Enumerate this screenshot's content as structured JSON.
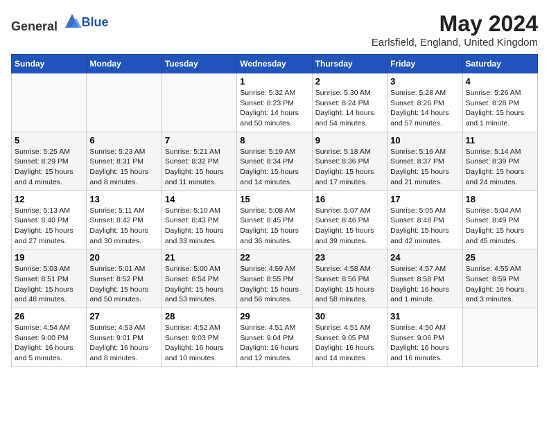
{
  "header": {
    "logo_general": "General",
    "logo_blue": "Blue",
    "title": "May 2024",
    "subtitle": "Earlsfield, England, United Kingdom"
  },
  "days_of_week": [
    "Sunday",
    "Monday",
    "Tuesday",
    "Wednesday",
    "Thursday",
    "Friday",
    "Saturday"
  ],
  "weeks": [
    [
      {
        "day": "",
        "info": ""
      },
      {
        "day": "",
        "info": ""
      },
      {
        "day": "",
        "info": ""
      },
      {
        "day": "1",
        "info": "Sunrise: 5:32 AM\nSunset: 8:23 PM\nDaylight: 14 hours\nand 50 minutes."
      },
      {
        "day": "2",
        "info": "Sunrise: 5:30 AM\nSunset: 8:24 PM\nDaylight: 14 hours\nand 54 minutes."
      },
      {
        "day": "3",
        "info": "Sunrise: 5:28 AM\nSunset: 8:26 PM\nDaylight: 14 hours\nand 57 minutes."
      },
      {
        "day": "4",
        "info": "Sunrise: 5:26 AM\nSunset: 8:28 PM\nDaylight: 15 hours\nand 1 minute."
      }
    ],
    [
      {
        "day": "5",
        "info": "Sunrise: 5:25 AM\nSunset: 8:29 PM\nDaylight: 15 hours\nand 4 minutes."
      },
      {
        "day": "6",
        "info": "Sunrise: 5:23 AM\nSunset: 8:31 PM\nDaylight: 15 hours\nand 8 minutes."
      },
      {
        "day": "7",
        "info": "Sunrise: 5:21 AM\nSunset: 8:32 PM\nDaylight: 15 hours\nand 11 minutes."
      },
      {
        "day": "8",
        "info": "Sunrise: 5:19 AM\nSunset: 8:34 PM\nDaylight: 15 hours\nand 14 minutes."
      },
      {
        "day": "9",
        "info": "Sunrise: 5:18 AM\nSunset: 8:36 PM\nDaylight: 15 hours\nand 17 minutes."
      },
      {
        "day": "10",
        "info": "Sunrise: 5:16 AM\nSunset: 8:37 PM\nDaylight: 15 hours\nand 21 minutes."
      },
      {
        "day": "11",
        "info": "Sunrise: 5:14 AM\nSunset: 8:39 PM\nDaylight: 15 hours\nand 24 minutes."
      }
    ],
    [
      {
        "day": "12",
        "info": "Sunrise: 5:13 AM\nSunset: 8:40 PM\nDaylight: 15 hours\nand 27 minutes."
      },
      {
        "day": "13",
        "info": "Sunrise: 5:11 AM\nSunset: 8:42 PM\nDaylight: 15 hours\nand 30 minutes."
      },
      {
        "day": "14",
        "info": "Sunrise: 5:10 AM\nSunset: 8:43 PM\nDaylight: 15 hours\nand 33 minutes."
      },
      {
        "day": "15",
        "info": "Sunrise: 5:08 AM\nSunset: 8:45 PM\nDaylight: 15 hours\nand 36 minutes."
      },
      {
        "day": "16",
        "info": "Sunrise: 5:07 AM\nSunset: 8:46 PM\nDaylight: 15 hours\nand 39 minutes."
      },
      {
        "day": "17",
        "info": "Sunrise: 5:05 AM\nSunset: 8:48 PM\nDaylight: 15 hours\nand 42 minutes."
      },
      {
        "day": "18",
        "info": "Sunrise: 5:04 AM\nSunset: 8:49 PM\nDaylight: 15 hours\nand 45 minutes."
      }
    ],
    [
      {
        "day": "19",
        "info": "Sunrise: 5:03 AM\nSunset: 8:51 PM\nDaylight: 15 hours\nand 48 minutes."
      },
      {
        "day": "20",
        "info": "Sunrise: 5:01 AM\nSunset: 8:52 PM\nDaylight: 15 hours\nand 50 minutes."
      },
      {
        "day": "21",
        "info": "Sunrise: 5:00 AM\nSunset: 8:54 PM\nDaylight: 15 hours\nand 53 minutes."
      },
      {
        "day": "22",
        "info": "Sunrise: 4:59 AM\nSunset: 8:55 PM\nDaylight: 15 hours\nand 56 minutes."
      },
      {
        "day": "23",
        "info": "Sunrise: 4:58 AM\nSunset: 8:56 PM\nDaylight: 15 hours\nand 58 minutes."
      },
      {
        "day": "24",
        "info": "Sunrise: 4:57 AM\nSunset: 8:58 PM\nDaylight: 16 hours\nand 1 minute."
      },
      {
        "day": "25",
        "info": "Sunrise: 4:55 AM\nSunset: 8:59 PM\nDaylight: 16 hours\nand 3 minutes."
      }
    ],
    [
      {
        "day": "26",
        "info": "Sunrise: 4:54 AM\nSunset: 9:00 PM\nDaylight: 16 hours\nand 5 minutes."
      },
      {
        "day": "27",
        "info": "Sunrise: 4:53 AM\nSunset: 9:01 PM\nDaylight: 16 hours\nand 8 minutes."
      },
      {
        "day": "28",
        "info": "Sunrise: 4:52 AM\nSunset: 9:03 PM\nDaylight: 16 hours\nand 10 minutes."
      },
      {
        "day": "29",
        "info": "Sunrise: 4:51 AM\nSunset: 9:04 PM\nDaylight: 16 hours\nand 12 minutes."
      },
      {
        "day": "30",
        "info": "Sunrise: 4:51 AM\nSunset: 9:05 PM\nDaylight: 16 hours\nand 14 minutes."
      },
      {
        "day": "31",
        "info": "Sunrise: 4:50 AM\nSunset: 9:06 PM\nDaylight: 16 hours\nand 16 minutes."
      },
      {
        "day": "",
        "info": ""
      }
    ]
  ]
}
